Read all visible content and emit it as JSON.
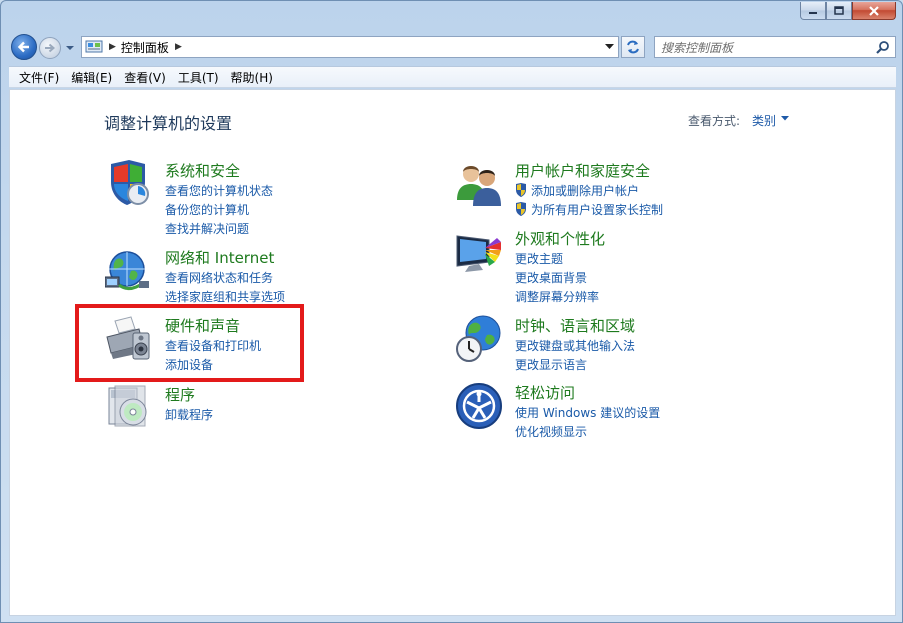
{
  "window": {
    "caption_buttons": [
      "minimize-icon",
      "maximize-icon",
      "close-icon"
    ]
  },
  "nav": {
    "breadcrumb": "控制面板",
    "search_placeholder": "搜索控制面板"
  },
  "menu": [
    "文件(F)",
    "编辑(E)",
    "查看(V)",
    "工具(T)",
    "帮助(H)"
  ],
  "main": {
    "title": "调整计算机的设置",
    "view_by_label": "查看方式:",
    "view_by_value": "类别"
  },
  "categories": [
    {
      "title": "系统和安全",
      "icon": "shield-icon",
      "links": [
        "查看您的计算机状态",
        "备份您的计算机",
        "查找并解决问题"
      ]
    },
    {
      "title": "网络和 Internet",
      "icon": "network-globe-icon",
      "links": [
        "查看网络状态和任务",
        "选择家庭组和共享选项"
      ]
    },
    {
      "title": "硬件和声音",
      "icon": "printer-speaker-icon",
      "links": [
        "查看设备和打印机",
        "添加设备"
      ]
    },
    {
      "title": "程序",
      "icon": "programs-disc-icon",
      "links": [
        "卸载程序"
      ]
    },
    {
      "title": "用户帐户和家庭安全",
      "icon": "users-icon",
      "links": [
        "添加或删除用户帐户",
        "为所有用户设置家长控制"
      ]
    },
    {
      "title": "外观和个性化",
      "icon": "monitor-palette-icon",
      "links": [
        "更改主题",
        "更改桌面背景",
        "调整屏幕分辨率"
      ]
    },
    {
      "title": "时钟、语言和区域",
      "icon": "globe-clock-icon",
      "links": [
        "更改键盘或其他输入法",
        "更改显示语言"
      ]
    },
    {
      "title": "轻松访问",
      "icon": "ease-of-access-icon",
      "links": [
        "使用 Windows 建议的设置",
        "优化视频显示"
      ]
    }
  ],
  "colors": {
    "category_title": "#1e7a1e",
    "link": "#1a5aa8",
    "highlight_box": "#e31a1a"
  }
}
